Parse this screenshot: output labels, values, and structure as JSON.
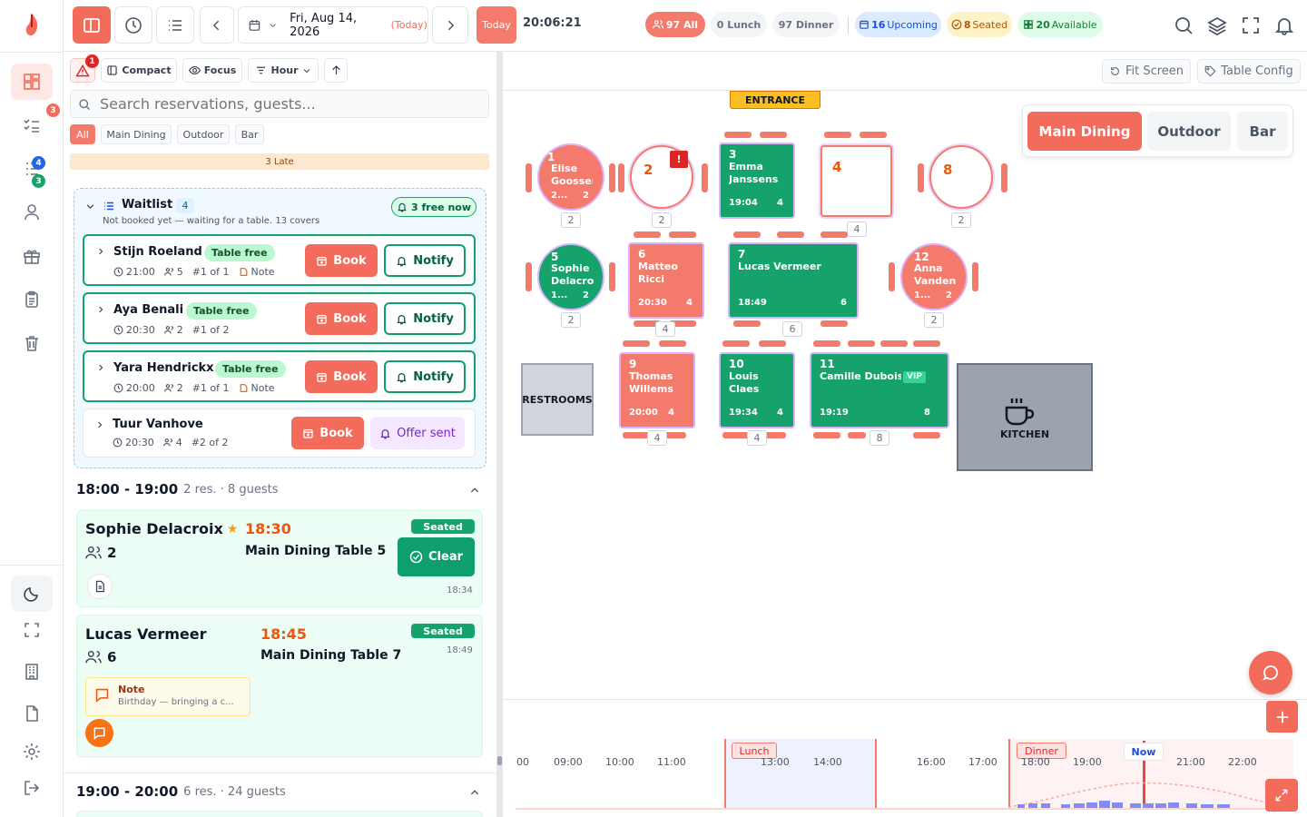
{
  "topbar": {
    "date": "Fri, Aug 14, 2026",
    "today_tag": "(Today)",
    "today_button": "Today",
    "clock": "20:06:21",
    "stats": {
      "all": "97 All",
      "lunch": "0 Lunch",
      "dinner": "97 Dinner",
      "upcoming_num": "16",
      "upcoming_label": "Upcoming",
      "seated_num": "8",
      "seated_label": "Seated",
      "available_num": "20",
      "available_label": "Available"
    }
  },
  "nav": {
    "badge_a": "3",
    "badge_b": "4",
    "badge_c": "3",
    "alert_badge": "1"
  },
  "toolbar": {
    "compact": "Compact",
    "focus": "Focus",
    "hour": "Hour"
  },
  "search": {
    "placeholder": "Search reservations, guests..."
  },
  "filters": [
    "All",
    "Main Dining",
    "Outdoor",
    "Bar"
  ],
  "late_banner": "3 Late",
  "waitlist": {
    "title": "Waitlist",
    "count": "4",
    "subtitle": "Not booked yet — waiting for a table. 13 covers",
    "free_now": "3 free now",
    "entries": [
      {
        "name": "Stijn Roeland",
        "badge": "Table free",
        "time": "21:00",
        "guests": "5",
        "pos": "#1 of 1",
        "note": "Note",
        "book": "Book",
        "action": "Notify"
      },
      {
        "name": "Aya Benali",
        "badge": "Table free",
        "time": "20:30",
        "guests": "2",
        "pos": "#1 of 2",
        "note": "",
        "book": "Book",
        "action": "Notify"
      },
      {
        "name": "Yara Hendrickx",
        "badge": "Table free",
        "time": "20:00",
        "guests": "2",
        "pos": "#1 of 1",
        "note": "Note",
        "book": "Book",
        "action": "Notify"
      },
      {
        "name": "Tuur Vanhove",
        "badge": "",
        "time": "20:30",
        "guests": "4",
        "pos": "#2 of 2",
        "note": "",
        "book": "Book",
        "action": "Offer sent"
      }
    ]
  },
  "slots": [
    {
      "range": "18:00 - 19:00",
      "meta": "2 res. · 8 guests"
    },
    {
      "range": "19:00 - 20:00",
      "meta": "6 res. · 24 guests"
    }
  ],
  "reservations": [
    {
      "name": "Sophie Delacroix",
      "time": "18:30",
      "guests": "2",
      "table": "Main Dining Table 5",
      "status": "Seated",
      "action": "Clear",
      "seated_at": "18:34"
    },
    {
      "name": "Lucas Vermeer",
      "time": "18:45",
      "guests": "6",
      "table": "Main Dining Table 7",
      "status": "Seated",
      "seated_at": "18:49",
      "note_title": "Note",
      "note_text": "Birthday — bringing a c..."
    }
  ],
  "floor": {
    "fit_screen": "Fit Screen",
    "table_config": "Table Config",
    "entrance": "ENTRANCE",
    "restrooms": "RESTROOMS",
    "kitchen": "KITCHEN",
    "zones": [
      "Main Dining",
      "Outdoor",
      "Bar"
    ],
    "tables": {
      "t1": {
        "num": "1",
        "name": "Elise Goossens",
        "time": "2...",
        "guests": "2",
        "cap": "2"
      },
      "t2": {
        "num": "2",
        "alert": "!",
        "cap": "2"
      },
      "t3": {
        "num": "3",
        "name": "Emma Janssens",
        "time": "19:04",
        "guests": "4",
        "cap": "4"
      },
      "t4": {
        "num": "4",
        "cap": "4"
      },
      "t8": {
        "num": "8",
        "cap": "2"
      },
      "t5": {
        "num": "5",
        "name": "Sophie Delacroix",
        "time": "1...",
        "guests": "2",
        "cap": "2"
      },
      "t6": {
        "num": "6",
        "name": "Matteo Ricci",
        "time": "20:30",
        "guests": "4",
        "cap": "4"
      },
      "t7": {
        "num": "7",
        "name": "Lucas Vermeer",
        "time": "18:49",
        "guests": "6",
        "cap": "6"
      },
      "t12": {
        "num": "12",
        "name": "Anna Vanden",
        "time": "1...",
        "guests": "2",
        "cap": "2"
      },
      "t9": {
        "num": "9",
        "name": "Thomas Willems",
        "time": "20:00",
        "guests": "4",
        "cap": "4"
      },
      "t10": {
        "num": "10",
        "name": "Louis Claes",
        "time": "19:34",
        "guests": "4",
        "cap": "4"
      },
      "t11": {
        "num": "11",
        "name": "Camille Dubois",
        "vip": "VIP",
        "time": "19:19",
        "guests": "8",
        "cap": "8"
      }
    }
  },
  "timeline": {
    "hours": [
      "00",
      "09:00",
      "10:00",
      "11:00",
      "13:00",
      "14:00",
      "16:00",
      "17:00",
      "18:00",
      "19:00",
      "21:00",
      "22:00"
    ],
    "lunch_label": "Lunch",
    "dinner_label": "Dinner",
    "now_label": "Now"
  },
  "colors": {
    "accent": "#f26b5b",
    "seated": "#16a36b",
    "purple_ring": "#d8b4fe"
  }
}
